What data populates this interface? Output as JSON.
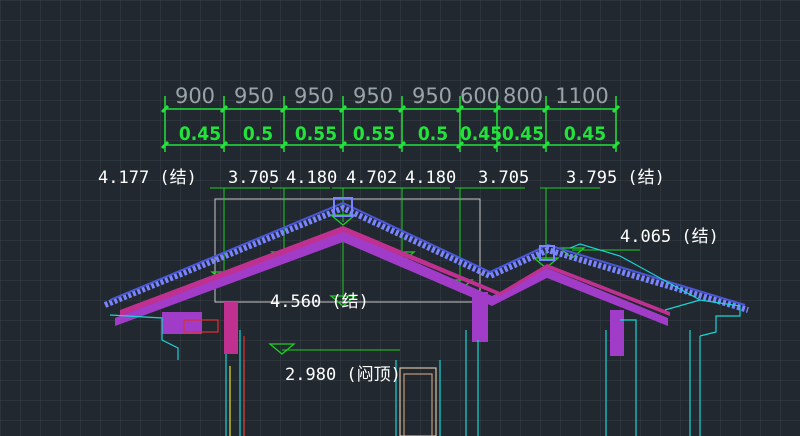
{
  "drawing": {
    "spacings_top": [
      "900",
      "950",
      "950",
      "950",
      "950",
      "600",
      "800",
      "1100"
    ],
    "spacings_bottom": [
      "0.45",
      "0.5",
      "0.55",
      "0.55",
      "0.5",
      "0.45",
      "0.45",
      "0.45"
    ],
    "elevations": {
      "e1": "4.177 (结)",
      "e2": "3.705",
      "e3": "4.180",
      "e4": "4.702",
      "e5": "4.180",
      "e6": "3.705",
      "e7": "3.795 (结)",
      "e8": "4.065 (结)",
      "e9": "4.560 (结)",
      "e10": "2.980 (闷顶)"
    }
  },
  "colors": {
    "background": "#212830",
    "grid": "#394048",
    "dimension_green": "#22e33a",
    "dimension_grey": "#9aa3aa",
    "rafter_magenta": "#a03cc8",
    "tile_blue": "#7a84ff",
    "cyan_outline": "#18d6d6",
    "marker_green": "#1ccf22"
  }
}
